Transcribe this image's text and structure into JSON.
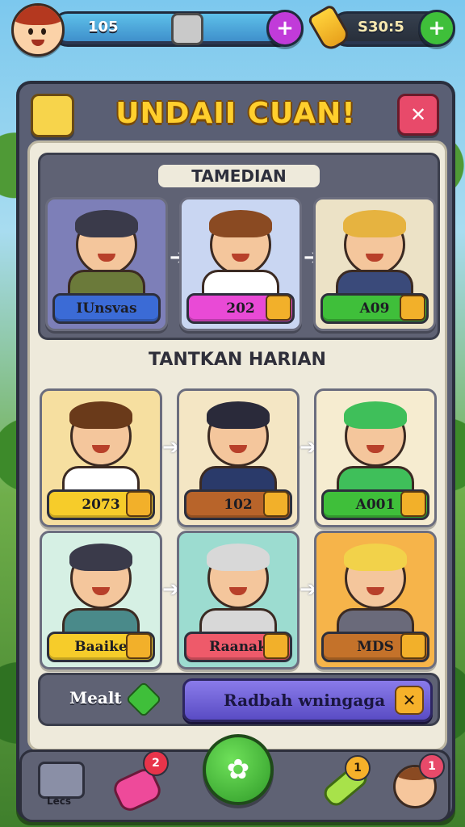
{
  "topbar": {
    "coins_value": "105",
    "gems_value": "S30:5",
    "plus_left": "+",
    "plus_right": "+"
  },
  "panel": {
    "title": "UNDAII CUAN!",
    "close_label": "✕"
  },
  "section_a": {
    "title": "TAMEDIAN",
    "cards": [
      {
        "label": "IUnsvas",
        "bg": "#7d7fb8",
        "label_color": "#3b6bd6",
        "hair": "#3a3a4a",
        "shirt": "#6b7a3a"
      },
      {
        "label": "202",
        "bg": "#c9d6f2",
        "label_color": "#e94ad6",
        "hair": "#8a4a22",
        "shirt": "#ffffff"
      },
      {
        "label": "A09",
        "bg": "#ece2c6",
        "label_color": "#3fbf3a",
        "hair": "#e6b340",
        "shirt": "#3a4a7a"
      }
    ]
  },
  "section_b": {
    "title": "TANTKAN HARIAN",
    "cards": [
      {
        "label": "2073",
        "bg": "#f6dfa0",
        "label_color": "#f6cc2a",
        "hair": "#6a3a1a",
        "shirt": "#ffffff"
      },
      {
        "label": "102",
        "bg": "#f4e6c4",
        "label_color": "#b8642a",
        "hair": "#2a2a3a",
        "shirt": "#2a3a6a"
      },
      {
        "label": "A001",
        "bg": "#f6ecd0",
        "label_color": "#3fbf3a",
        "hair": "#3fbf5a",
        "shirt": "#3fbf5a"
      },
      {
        "label": "Baaike",
        "bg": "#d6f0e4",
        "label_color": "#f6cc2a",
        "hair": "#3a3a4a",
        "shirt": "#4a8a8a"
      },
      {
        "label": "Raanak",
        "bg": "#9cdcd0",
        "label_color": "#ee5a6a",
        "hair": "#d8d8d8",
        "shirt": "#d8d8d8"
      },
      {
        "label": "MDS",
        "bg": "#f6b44a",
        "label_color": "#c4722a",
        "hair": "#f2d24a",
        "shirt": "#6a6a7a"
      }
    ]
  },
  "menu": {
    "label": "Mealt",
    "action_label": "Radbah wningaga",
    "action_close": "✕"
  },
  "bottom_nav": {
    "home_label": "Lecs",
    "gift_badge": "2",
    "item4_badge": "1",
    "avatar_badge": "1",
    "center_icon": "✿"
  }
}
